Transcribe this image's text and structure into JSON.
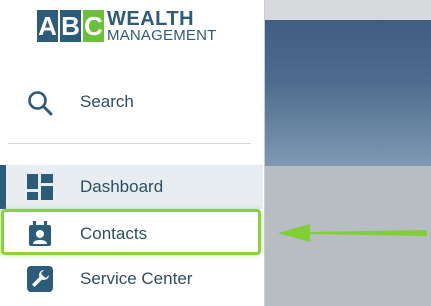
{
  "logo": {
    "letters": [
      "A",
      "B",
      "C"
    ],
    "word1": "WEALTH",
    "word2": "MANAGEMENT"
  },
  "search": {
    "label": "Search",
    "icon": "search-icon"
  },
  "nav": {
    "items": [
      {
        "label": "Dashboard",
        "icon": "dashboard-icon",
        "active": true
      },
      {
        "label": "Contacts",
        "icon": "contacts-icon",
        "highlighted": true
      },
      {
        "label": "Service Center",
        "icon": "wrench-icon"
      }
    ]
  },
  "colors": {
    "brand_blue": "#2d5b7a",
    "brand_green": "#6cbf3a",
    "highlight_green": "#8ad33c",
    "text": "#2d4d63"
  }
}
